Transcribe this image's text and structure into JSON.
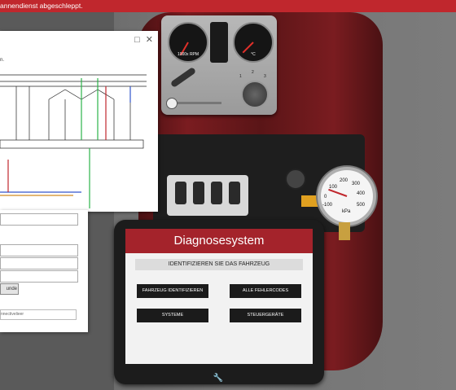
{
  "notification": {
    "text": "annendienst abgeschleppt."
  },
  "schematic_window": {
    "label": "n."
  },
  "instrument_panel": {
    "rpm_gauge_label": "1000x RPM",
    "temp_gauge_label": "°C",
    "knob_numbers": [
      "1",
      "2",
      "3"
    ]
  },
  "pressure_gauge": {
    "ticks": [
      "-100",
      "0",
      "100",
      "200",
      "300",
      "400",
      "500"
    ],
    "unit": "kPa"
  },
  "form_panel": {
    "button_fragment": "unde",
    "footer_fragment": "nnectivelieer"
  },
  "tablet": {
    "title": "Diagnosesystem",
    "subtitle": "IDENTIFIZIEREN SIE DAS FAHRZEUG",
    "buttons": {
      "identify": "FAHRZEUG IDENTIFIZIEREN",
      "fault_codes": "ALLE FEHLERCODES",
      "systems": "SYSTEME",
      "ecus": "STEUERGERÄTE"
    }
  },
  "colors": {
    "accent": "#c0272d",
    "tablet_header": "#a4232b"
  }
}
